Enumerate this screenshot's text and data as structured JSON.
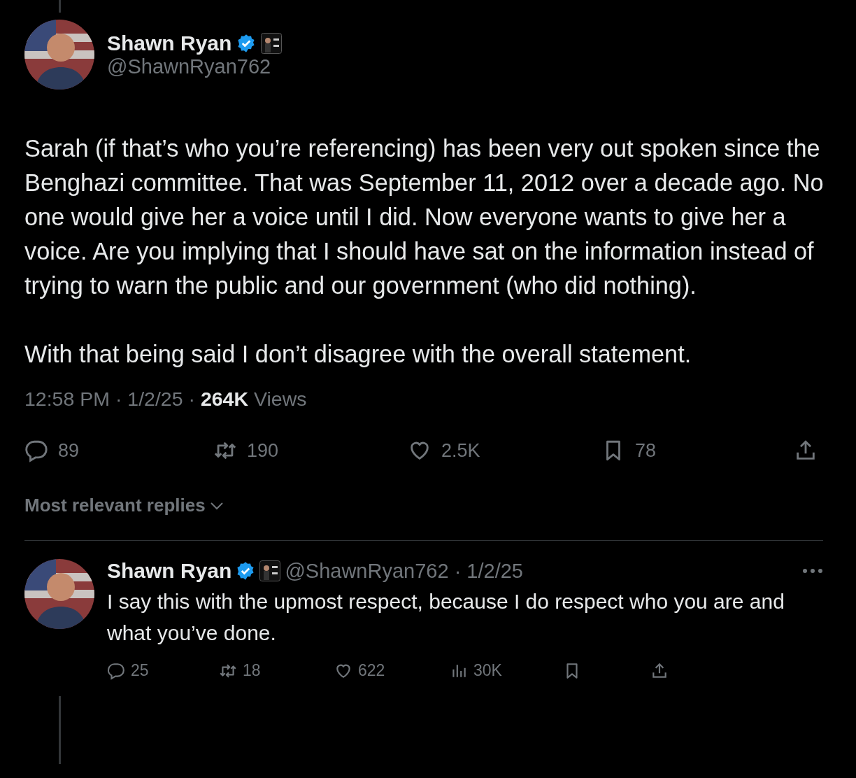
{
  "tweet": {
    "author": {
      "name": "Shawn Ryan",
      "handle": "@ShawnRyan762",
      "verified": true
    },
    "paragraphs": [
      "Sarah (if that’s who you’re referencing) has been very out spoken since the Benghazi committee. That was September 11, 2012 over a decade ago. No one would give her a voice until I did. Now everyone wants to give her a voice. Are you implying that I should have sat on the information instead of trying to warn the public and our government (who did nothing).",
      "With that being said I don’t disagree with the overall statement."
    ],
    "meta": "12:58 PM · 1/2/25 · **264K** Views",
    "actions": [
      {
        "kind": "reply",
        "count": "89"
      },
      {
        "kind": "repost",
        "count": "190"
      },
      {
        "kind": "like",
        "count": "2.5K"
      },
      {
        "kind": "bookmark",
        "count": "78"
      },
      {
        "kind": "share"
      }
    ]
  },
  "replies_sort": {
    "label": "Most relevant replies"
  },
  "replies": [
    {
      "author": {
        "name": "Shawn Ryan",
        "handle": "@ShawnRyan762 · 1/2/25",
        "verified": true
      },
      "text": "I say this with the upmost respect, because I do respect who you are and what you’ve done.",
      "actions": [
        {
          "kind": "reply",
          "count": "25"
        },
        {
          "kind": "repost",
          "count": "18"
        },
        {
          "kind": "like",
          "count": "622"
        },
        {
          "kind": "views",
          "count": "30K"
        },
        {
          "kind": "bookmark"
        },
        {
          "kind": "share"
        }
      ]
    }
  ]
}
